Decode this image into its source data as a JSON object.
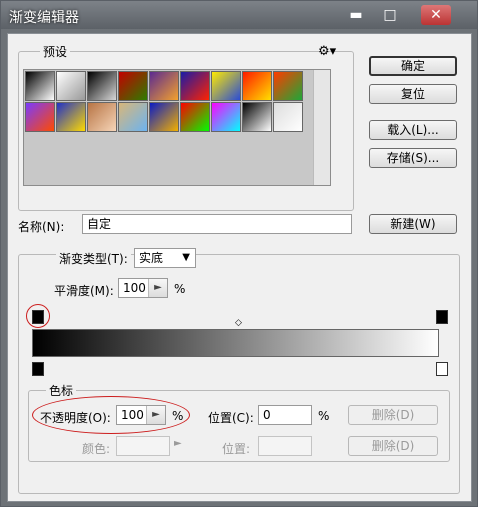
{
  "window": {
    "title": "渐变编辑器",
    "controls": [
      "minimize-icon",
      "maximize-icon",
      "close-icon"
    ]
  },
  "presets": {
    "legend": "预设",
    "menu_icon": "gear-icon",
    "swatches_colors": [
      [
        "#000000",
        "#ffffff"
      ],
      [
        "#ffffff",
        "#999999"
      ],
      [
        "#000000",
        "#d8d8d8"
      ],
      [
        "#c30000",
        "#2d7d00"
      ],
      [
        "#5b2a91",
        "#f3a12d"
      ],
      [
        "#1a1aa8",
        "#ff2200"
      ],
      [
        "#ffea00",
        "#2a4cd6"
      ],
      [
        "#ff1a00",
        "#ffe000"
      ],
      [
        "#ff3b00",
        "#1ea838"
      ],
      [
        "#7a3bff",
        "#ff4a00"
      ],
      [
        "#2031c8",
        "#ffda00"
      ],
      [
        "#b77444",
        "#f6d5b8"
      ],
      [
        "#d8b67a",
        "#6cb4f0"
      ],
      [
        "#0a1cc4",
        "#f2b000"
      ],
      [
        "#ff0000",
        "#00ff00"
      ],
      [
        "#ff00ff",
        "#00ffff"
      ],
      [
        "#000000",
        "#ffffff"
      ],
      [
        "#dddddd",
        "#ffffff"
      ]
    ]
  },
  "buttons": {
    "ok": "确定",
    "reset": "复位",
    "load": "载入(L)...",
    "save": "存储(S)...",
    "new": "新建(W)"
  },
  "name": {
    "label": "名称(N):",
    "value": "自定"
  },
  "gradient": {
    "type_label": "渐变类型(T):",
    "type_value": "实底",
    "smoothness_label": "平滑度(M):",
    "smoothness_value": "100",
    "percent": "%",
    "start_color": "#000000",
    "end_color": "#ffffff"
  },
  "color_stops": {
    "legend": "色标",
    "opacity_label": "不透明度(O):",
    "opacity_value": "100",
    "opacity_percent": "%",
    "position_label": "位置(C):",
    "position_value": "0",
    "position_percent": "%",
    "delete_label": "删除(D)",
    "color_label": "颜色:",
    "color_position_label": "位置:",
    "color_delete_label": "删除(D)"
  },
  "accent_colors": {
    "annotation": "#cc1d1d"
  }
}
